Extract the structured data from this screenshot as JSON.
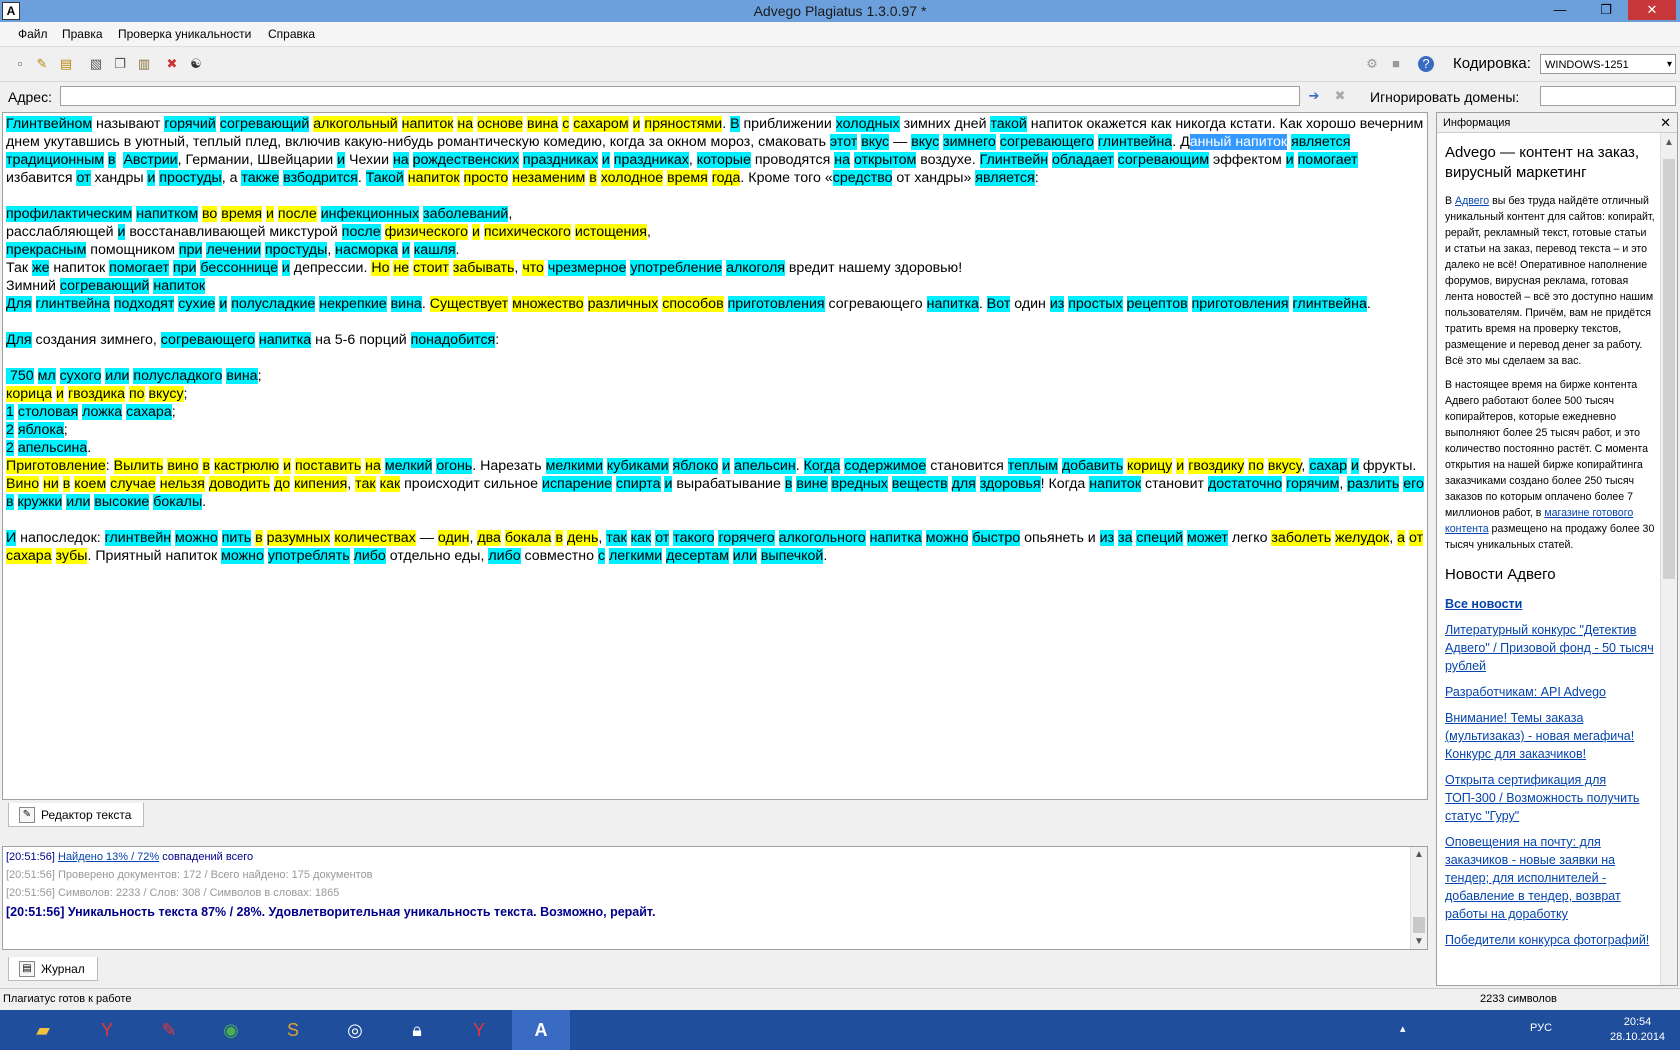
{
  "window": {
    "title": "Advego Plagiatus 1.3.0.97 *",
    "app_icon": "A",
    "minimize": "—",
    "maximize": "❐",
    "close": "✕"
  },
  "menu": {
    "file": "Файл",
    "edit": "Правка",
    "check": "Проверка уникальности",
    "help": "Справка"
  },
  "toolbar": {
    "encoding_label": "Кодировка:",
    "encoding_value": "WINDOWS-1251"
  },
  "address": {
    "label": "Адрес:",
    "value": "",
    "ignore_label": "Игнорировать домены:",
    "ignore_value": ""
  },
  "tabs": {
    "editor": "Редактор текста",
    "journal": "Журнал"
  },
  "log": {
    "line1_time": "[20:51:56]",
    "line1_link": "Найдено 13% / 72%",
    "line1_rest": " совпадений всего",
    "line2": "[20:51:56] Проверено документов: 172  / Всего найдено: 175 документов",
    "line3": "[20:51:56] Символов: 2233 / Слов: 308 / Символов в словах: 1865",
    "line4": "[20:51:56] Уникальность текста 87% / 28%. Удовлетворительная уникальность текста. Возможно, рерайт."
  },
  "info": {
    "header": "Информация",
    "title": "Advego — контент на заказ, вирусный маркетинг",
    "p1_pre": "В ",
    "p1_link": "Адвего",
    "p1_post": " вы без труда найдёте отличный уникальный контент для сайтов: копирайт, рерайт, рекламный текст, готовые статьи и статьи на заказ, перевод текста – и это далеко не всё! Оперативное наполнение форумов, вирусная реклама, готовая лента новостей – всё это доступно нашим пользователям. Причём, вам не придётся тратить время на проверку текстов, размещение и перевод денег за работу. Всё это мы сделаем за вас.",
    "p2_pre": "В настоящее время на бирже контента Адвего работают более 500 тысяч копирайтеров, которые ежедневно выполняют более 25 тысяч работ, и это количество постоянно растёт. С момента открытия на нашей бирже копирайтинга заказчиками создано более 250 тысяч заказов по которым оплачено более 7 миллионов работ, в ",
    "p2_link": "магазине готового контента",
    "p2_post": " размещено на продажу более 30 тысяч уникальных статей.",
    "news_title": "Новости Адвего",
    "news": [
      "Все новости",
      "Литературный конкурс \"Детектив Адвего\" / Призовой фонд - 50 тысяч рублей",
      "Разработчикам: API Advego",
      "Внимание! Темы заказа (мультизаказ) - новая мегафича! Конкурс для заказчиков!",
      "Открыта сертификация для ТОП-300 / Возможность получить статус \"Гуру\"",
      "Оповещения на почту: для заказчиков - новые заявки на тендер; для исполнителей - добавление в тендер, возврат работы на доработку",
      "Победители конкурса фотографий!"
    ]
  },
  "status": {
    "left": "Плагиатус готов к работе",
    "right": "2233 символов"
  },
  "taskbar": {
    "lang": "РУС",
    "time": "20:54",
    "date": "28.10.2014"
  }
}
